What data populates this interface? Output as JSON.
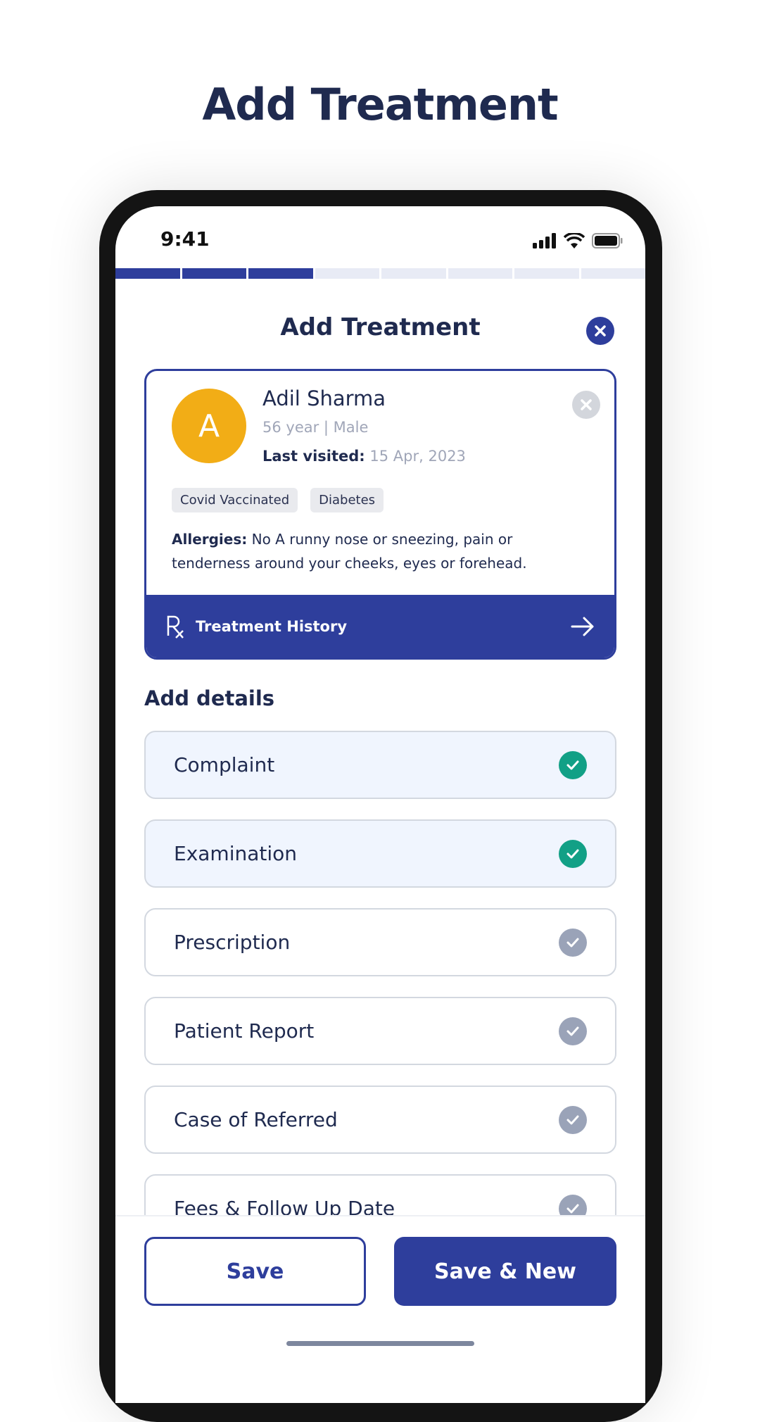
{
  "page_title": "Add Treatment",
  "status_bar": {
    "time": "9:41",
    "icons": [
      "signal-icon",
      "wifi-icon",
      "battery-icon"
    ]
  },
  "progress": {
    "total_steps": 8,
    "completed_steps": 3
  },
  "header": {
    "title": "Add Treatment",
    "close_icon": "close-icon"
  },
  "patient": {
    "initial": "A",
    "name": "Adil Sharma",
    "age_gender": "56 year |  Male",
    "last_visited_label": "Last visited:",
    "last_visited_value": "15 Apr, 2023",
    "tags": [
      "Covid Vaccinated",
      "Diabetes"
    ],
    "allergies_label": "Allergies:",
    "allergies_text": "No A runny nose or sneezing, pain or tenderness around your cheeks, eyes or forehead.",
    "history_label": "Treatment History"
  },
  "details": {
    "title": "Add details",
    "items": [
      {
        "label": "Complaint",
        "done": true
      },
      {
        "label": "Examination",
        "done": true
      },
      {
        "label": "Prescription",
        "done": false
      },
      {
        "label": "Patient Report",
        "done": false
      },
      {
        "label": "Case of Referred",
        "done": false
      },
      {
        "label": "Fees & Follow Up Date",
        "done": false
      }
    ]
  },
  "actions": {
    "save": "Save",
    "save_new": "Save & New"
  },
  "colors": {
    "primary": "#2e3e9c",
    "success": "#12a086",
    "pending": "#9aa3b8",
    "avatar": "#f2ad16",
    "text": "#1f2a4f"
  }
}
